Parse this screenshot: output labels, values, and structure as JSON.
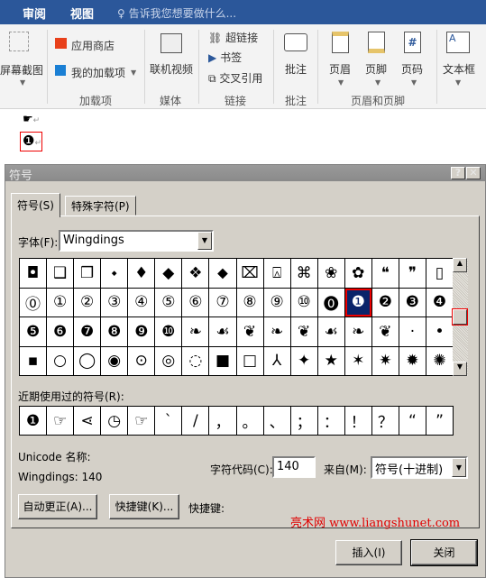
{
  "ribbon": {
    "tabs": [
      "审阅",
      "视图"
    ],
    "tell_me": "告诉我您想要做什么...",
    "screenshot": "屏幕截图",
    "store": "应用商店",
    "my_addins": "我的加载项",
    "addins_group": "加载项",
    "online_video": "联机视频",
    "media_group": "媒体",
    "hyperlink": "超链接",
    "bookmark": "书签",
    "crossref": "交叉引用",
    "links_group": "链接",
    "comment": "批注",
    "comment_group": "批注",
    "header": "页眉",
    "footer": "页脚",
    "page_number": "页码",
    "hf_group": "页眉和页脚",
    "textbox": "文本框"
  },
  "document": {
    "line1": "☛",
    "line2": "❶",
    "pilcrow": "↵"
  },
  "dialog": {
    "title": "符号",
    "help": "?",
    "close_x": "✕",
    "tabs": [
      "符号(S)",
      "特殊字符(P)"
    ],
    "font_label": "字体(F):",
    "font_value": "Wingdings",
    "symbols": [
      [
        "◘",
        "❑",
        "❒",
        "⬩",
        "♦",
        "◆",
        "❖",
        "⬥",
        "⌧",
        "⍓",
        "⌘",
        "❀",
        "✿",
        "❝",
        "❞",
        "▯"
      ],
      [
        "⓪",
        "①",
        "②",
        "③",
        "④",
        "⑤",
        "⑥",
        "⑦",
        "⑧",
        "⑨",
        "⑩",
        "⓿",
        "❶",
        "❷",
        "❸",
        "❹"
      ],
      [
        "❺",
        "❻",
        "❼",
        "❽",
        "❾",
        "❿",
        "❧",
        "☙",
        "❦",
        "❧",
        "❦",
        "☙",
        "❧",
        "❦",
        "·",
        "•"
      ],
      [
        "▪",
        "○",
        "◯",
        "◉",
        "⊙",
        "◎",
        "◌",
        "■",
        "□",
        "⅄",
        "✦",
        "★",
        "✶",
        "✷",
        "✹",
        "✺"
      ]
    ],
    "selected": {
      "row": 1,
      "col": 12
    },
    "recent_label": "近期使用过的符号(R):",
    "recent": [
      "❶",
      "☞",
      "⋖",
      "◷",
      "☞",
      "`",
      "/",
      "，",
      "。",
      "、",
      "；",
      "：",
      "！",
      "？",
      "“",
      "”"
    ],
    "unicode_name_label": "Unicode 名称:",
    "char_name": "Wingdings: 140",
    "char_code_label": "字符代码(C):",
    "char_code": "140",
    "from_label": "来自(M):",
    "from_value": "符号(十进制)",
    "autocorrect": "自动更正(A)...",
    "shortcut_key_btn": "快捷键(K)...",
    "shortcut_label": "快捷键:",
    "watermark": "亮术网 www.liangshunet.com",
    "insert": "插入(I)",
    "close": "关闭"
  },
  "colors": {
    "ribbon_blue": "#2b579a",
    "dialog_bg": "#d4d0c8",
    "selection": "#0a246a",
    "watermark": "#e00000"
  }
}
